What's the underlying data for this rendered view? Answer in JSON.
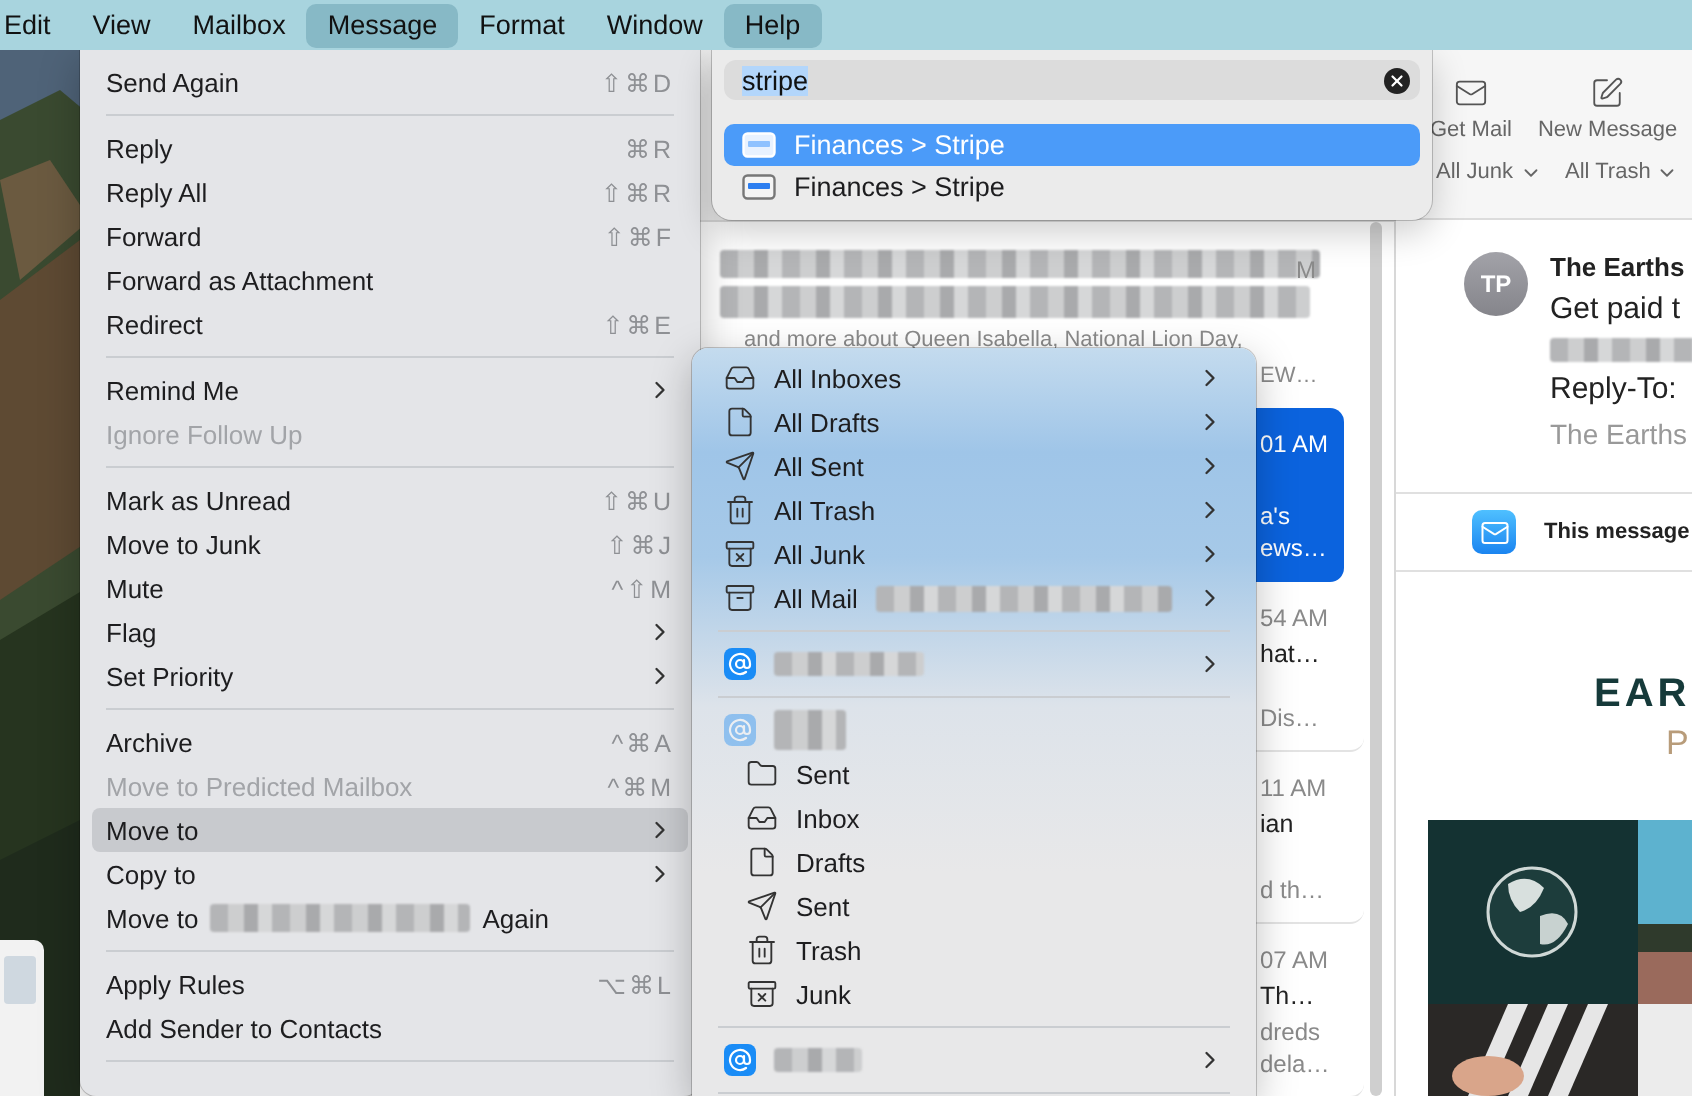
{
  "menu_bar": {
    "items": [
      {
        "label": "Edit",
        "selected": false
      },
      {
        "label": "View",
        "selected": false
      },
      {
        "label": "Mailbox",
        "selected": false
      },
      {
        "label": "Message",
        "selected": true
      },
      {
        "label": "Format",
        "selected": false
      },
      {
        "label": "Window",
        "selected": false
      },
      {
        "label": "Help",
        "selected": true
      }
    ]
  },
  "message_menu": {
    "items": [
      {
        "kind": "item",
        "label": "Send Again",
        "shortcut": "⇧⌘D",
        "submenu": false,
        "disabled": false,
        "selected": false
      },
      {
        "kind": "separator"
      },
      {
        "kind": "item",
        "label": "Reply",
        "shortcut": "⌘R",
        "submenu": false,
        "disabled": false,
        "selected": false
      },
      {
        "kind": "item",
        "label": "Reply All",
        "shortcut": "⇧⌘R",
        "submenu": false,
        "disabled": false,
        "selected": false
      },
      {
        "kind": "item",
        "label": "Forward",
        "shortcut": "⇧⌘F",
        "submenu": false,
        "disabled": false,
        "selected": false
      },
      {
        "kind": "item",
        "label": "Forward as Attachment",
        "submenu": false,
        "disabled": false,
        "selected": false
      },
      {
        "kind": "item",
        "label": "Redirect",
        "shortcut": "⇧⌘E",
        "submenu": false,
        "disabled": false,
        "selected": false
      },
      {
        "kind": "separator"
      },
      {
        "kind": "item",
        "label": "Remind Me",
        "submenu": true,
        "disabled": false,
        "selected": false
      },
      {
        "kind": "item",
        "label": "Ignore Follow Up",
        "submenu": false,
        "disabled": true,
        "selected": false
      },
      {
        "kind": "separator"
      },
      {
        "kind": "item",
        "label": "Mark as Unread",
        "shortcut": "⇧⌘U",
        "submenu": false,
        "disabled": false,
        "selected": false
      },
      {
        "kind": "item",
        "label": "Move to Junk",
        "shortcut": "⇧⌘J",
        "submenu": false,
        "disabled": false,
        "selected": false
      },
      {
        "kind": "item",
        "label": "Mute",
        "shortcut": "^⇧M",
        "submenu": false,
        "disabled": false,
        "selected": false
      },
      {
        "kind": "item",
        "label": "Flag",
        "submenu": true,
        "disabled": false,
        "selected": false
      },
      {
        "kind": "item",
        "label": "Set Priority",
        "submenu": true,
        "disabled": false,
        "selected": false
      },
      {
        "kind": "separator"
      },
      {
        "kind": "item",
        "label": "Archive",
        "shortcut": "^⌘A",
        "submenu": false,
        "disabled": false,
        "selected": false
      },
      {
        "kind": "item",
        "label": "Move to Predicted Mailbox",
        "shortcut": "^⌘M",
        "submenu": false,
        "disabled": true,
        "selected": false
      },
      {
        "kind": "item",
        "label": "Move to",
        "submenu": true,
        "disabled": false,
        "selected": true
      },
      {
        "kind": "item",
        "label": "Copy to",
        "submenu": true,
        "disabled": false,
        "selected": false
      },
      {
        "kind": "repeat",
        "label": "Move to",
        "suffix": "Again",
        "submenu": false,
        "disabled": false,
        "selected": false
      },
      {
        "kind": "separator"
      },
      {
        "kind": "item",
        "label": "Apply Rules",
        "shortcut": "⌥⌘L",
        "submenu": false,
        "disabled": false,
        "selected": false
      },
      {
        "kind": "item",
        "label": "Add Sender to Contacts",
        "submenu": false,
        "disabled": false,
        "selected": false
      },
      {
        "kind": "separator"
      }
    ]
  },
  "move_to_menu": {
    "items": [
      {
        "kind": "inboxes",
        "label": "All Inboxes",
        "submenu": true
      },
      {
        "kind": "drafts",
        "label": "All Drafts",
        "submenu": true
      },
      {
        "kind": "sent",
        "label": "All Sent",
        "submenu": true
      },
      {
        "kind": "trash",
        "label": "All Trash",
        "submenu": true
      },
      {
        "kind": "junk",
        "label": "All Junk",
        "submenu": true
      },
      {
        "kind": "archive",
        "label": "All Mail",
        "redacted": true,
        "submenu": true
      },
      {
        "kind": "separator"
      },
      {
        "kind": "account",
        "dimmed": false,
        "submenu": true
      },
      {
        "kind": "separator"
      },
      {
        "kind": "account",
        "dimmed": true,
        "submenu": false,
        "children": [
          {
            "kind": "folder",
            "label": "Sent"
          },
          {
            "kind": "inbox",
            "label": "Inbox"
          },
          {
            "kind": "drafts",
            "label": "Drafts"
          },
          {
            "kind": "sent",
            "label": "Sent"
          },
          {
            "kind": "trash",
            "label": "Trash"
          },
          {
            "kind": "junk",
            "label": "Junk"
          }
        ]
      },
      {
        "kind": "separator"
      },
      {
        "kind": "account",
        "dimmed": false,
        "submenu": true
      },
      {
        "kind": "separator"
      }
    ]
  },
  "search_popup": {
    "query": "stripe",
    "query_highlighted": true,
    "results": [
      {
        "label": "Finances > Stripe",
        "selected": true
      },
      {
        "label": "Finances > Stripe",
        "selected": false
      }
    ]
  },
  "message_list": {
    "first_message": {
      "time": "M",
      "preview": "and more about Queen Isabella, National Lion Day,",
      "preview_end": "EW…"
    },
    "messages": [
      {
        "selected": true,
        "time": "01 AM",
        "preview": [
          "a's",
          "ews…"
        ]
      },
      {
        "selected": false,
        "time": "54 AM",
        "subject": "hat…",
        "preview": [
          "Dis…"
        ]
      },
      {
        "selected": false,
        "time": "11 AM",
        "subject": "ian",
        "preview": [
          "d th…"
        ]
      },
      {
        "selected": false,
        "time": "07 AM",
        "subject": "Th…",
        "preview": [
          "dreds",
          "dela…"
        ]
      }
    ]
  },
  "toolbar": {
    "buttons": [
      {
        "kind": "get_mail",
        "label": "Get Mail"
      },
      {
        "kind": "compose",
        "label": "New Message"
      }
    ],
    "filters": [
      {
        "label": "All Junk"
      },
      {
        "label": "All Trash"
      }
    ]
  },
  "reader": {
    "avatar": "TP",
    "sender": "The Earths",
    "subject": "Get paid t",
    "reply_to_label": "Reply-To:",
    "reply_to": "The Earths",
    "banner": "This message",
    "logo": {
      "line_1": "EAR",
      "line_2": "P"
    }
  }
}
